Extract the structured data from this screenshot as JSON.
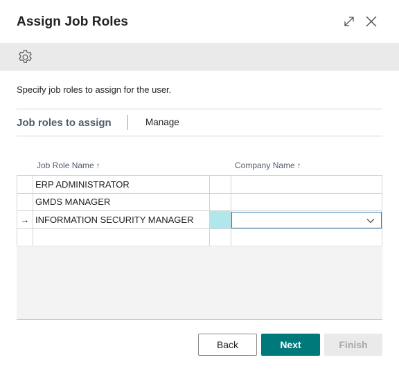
{
  "dialog": {
    "title": "Assign Job Roles"
  },
  "icons": {
    "expand": "expand-icon",
    "close": "close-icon",
    "settings": "gear-icon",
    "row_arrow": "arrow-right-icon",
    "sort": "arrow-up-icon",
    "dropdown": "chevron-down-icon"
  },
  "instruction": "Specify job roles to assign for the user.",
  "part": {
    "title": "Job roles to assign",
    "manage_label": "Manage"
  },
  "grid": {
    "columns": {
      "job_role_name": "Job Role Name",
      "company_name": "Company Name",
      "sort_glyph": "↑"
    },
    "rows": [
      {
        "indicator": "",
        "job_role_name": "ERP ADMINISTRATOR",
        "company_name": ""
      },
      {
        "indicator": "",
        "job_role_name": "GMDS MANAGER",
        "company_name": ""
      },
      {
        "indicator": "→",
        "job_role_name": "INFORMATION SECURITY MANAGER",
        "company_name": ""
      },
      {
        "indicator": "",
        "job_role_name": "",
        "company_name": ""
      }
    ]
  },
  "footer": {
    "back_label": "Back",
    "next_label": "Next",
    "finish_label": "Finish"
  },
  "colors": {
    "primary": "#00797a",
    "active_cell": "#b0e7ec",
    "focus_border": "#2b7bb9",
    "toolbar_bg": "#eaeaea"
  }
}
